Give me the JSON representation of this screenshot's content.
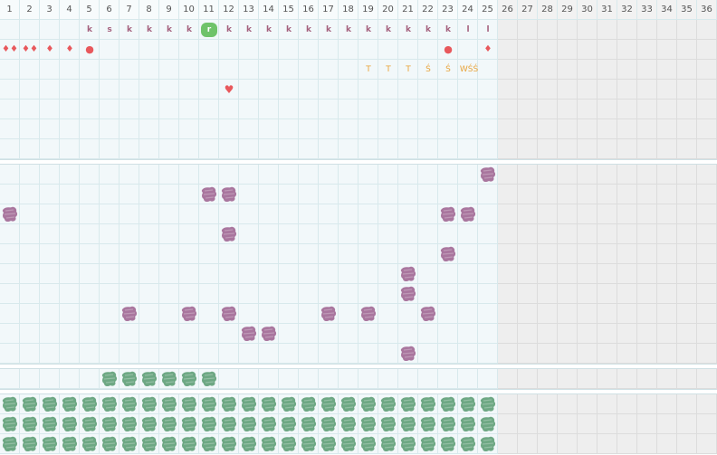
{
  "columns": [
    "1",
    "2",
    "3",
    "4",
    "5",
    "6",
    "7",
    "8",
    "9",
    "10",
    "11",
    "12",
    "13",
    "14",
    "15",
    "16",
    "17",
    "18",
    "19",
    "20",
    "21",
    "22",
    "23",
    "24",
    "25",
    "26",
    "27",
    "28",
    "29",
    "30",
    "31",
    "32",
    "33",
    "34",
    "35",
    "36"
  ],
  "active_columns": 25,
  "colors": {
    "k_letter": "#a4607d",
    "r_badge_bg": "#6fc36a",
    "r_badge_text": "#ffffff",
    "red": "#e8585c",
    "gold": "#e8a33a",
    "purple_blob": "#a9769e",
    "green_blob": "#6ea884",
    "grid_line": "#d8e9ec",
    "cell_bg": "#f2f8fa",
    "past_bg": "#eeeeee"
  },
  "row_letters": [
    "",
    "",
    "",
    "",
    "k",
    "s",
    "k",
    "k",
    "k",
    "k",
    "r",
    "k",
    "k",
    "k",
    "k",
    "k",
    "k",
    "k",
    "k",
    "k",
    "k",
    "k",
    "k",
    "l",
    "l"
  ],
  "row_icons": {
    "1": "♦♦",
    "2": "♦♦",
    "3": "♦",
    "4": "♦",
    "5": "●",
    "23": "●",
    "25": "♦"
  },
  "row_gold": {
    "19": "T",
    "20": "T",
    "21": "T",
    "22": "Ś",
    "23": "Ś",
    "24": "WŚŚ"
  },
  "heart": {
    "col": 12,
    "symbol": "♥"
  },
  "purple_blobs": [
    {
      "col": 25,
      "row": 0
    },
    {
      "col": 11,
      "row": 1
    },
    {
      "col": 12,
      "row": 1
    },
    {
      "col": 1,
      "row": 2
    },
    {
      "col": 23,
      "row": 2
    },
    {
      "col": 24,
      "row": 2
    },
    {
      "col": 12,
      "row": 3
    },
    {
      "col": 23,
      "row": 4
    },
    {
      "col": 21,
      "row": 5
    },
    {
      "col": 21,
      "row": 6
    },
    {
      "col": 7,
      "row": 7
    },
    {
      "col": 10,
      "row": 7
    },
    {
      "col": 12,
      "row": 7
    },
    {
      "col": 17,
      "row": 7
    },
    {
      "col": 19,
      "row": 7
    },
    {
      "col": 22,
      "row": 7
    },
    {
      "col": 13,
      "row": 8
    },
    {
      "col": 14,
      "row": 8
    },
    {
      "col": 21,
      "row": 9
    }
  ],
  "green_strip": [
    6,
    7,
    8,
    9,
    10,
    11
  ],
  "green_rows": 3
}
